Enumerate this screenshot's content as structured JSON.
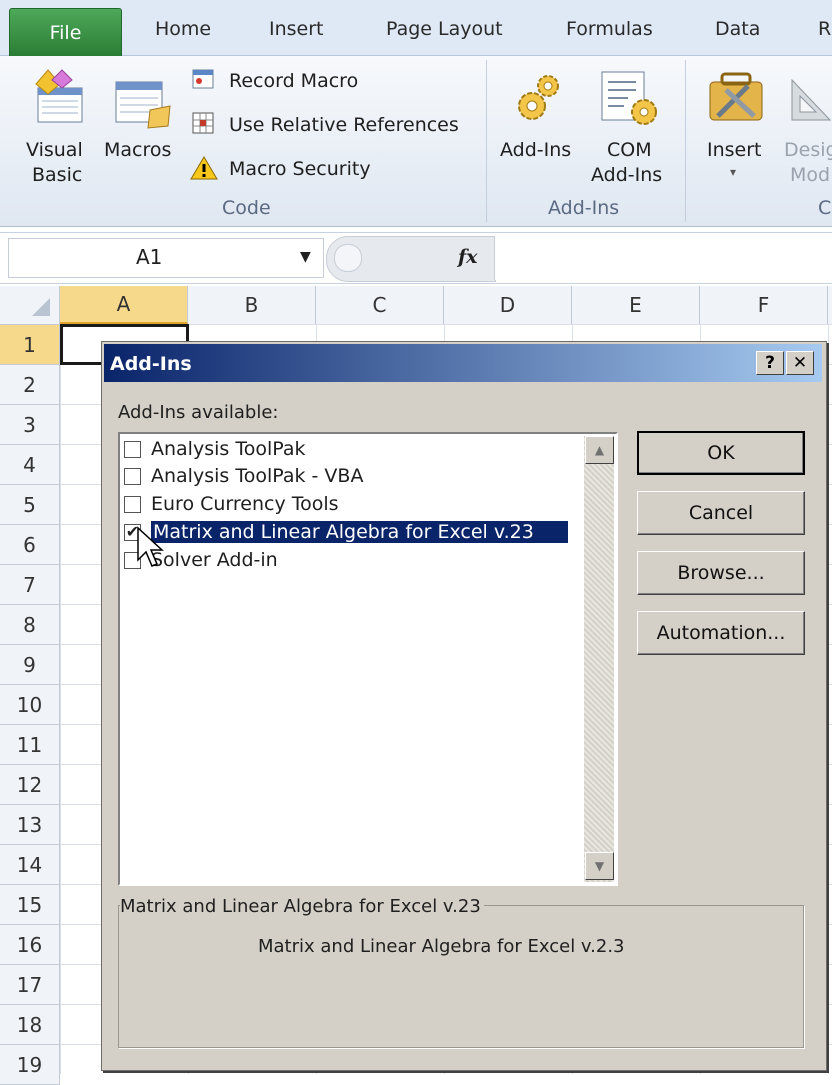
{
  "ribbon": {
    "tabs": [
      "File",
      "Home",
      "Insert",
      "Page Layout",
      "Formulas",
      "Data",
      "R"
    ],
    "code_group": {
      "visual_basic": [
        "Visual",
        "Basic"
      ],
      "macros": "Macros",
      "record_macro": "Record Macro",
      "use_relative": "Use Relative References",
      "macro_security": "Macro Security",
      "label": "Code"
    },
    "addins_group": {
      "addins": "Add-Ins",
      "com": [
        "COM",
        "Add-Ins"
      ],
      "label": "Add-Ins"
    },
    "controls_group": {
      "insert": "Insert",
      "design": [
        "Desig",
        "Mod"
      ],
      "label": "C"
    }
  },
  "formula_bar": {
    "name_box": "A1",
    "fx": "fx"
  },
  "columns": [
    "A",
    "B",
    "C",
    "D",
    "E",
    "F"
  ],
  "rows": [
    "1",
    "2",
    "3",
    "4",
    "5",
    "6",
    "7",
    "8",
    "9",
    "10",
    "11",
    "12",
    "13",
    "14",
    "15",
    "16",
    "17",
    "18",
    "19"
  ],
  "dialog": {
    "title": "Add-Ins",
    "help": "?",
    "close": "✕",
    "available_label": "Add-Ins available:",
    "items": [
      {
        "label": "Analysis ToolPak",
        "checked": false
      },
      {
        "label": "Analysis ToolPak - VBA",
        "checked": false
      },
      {
        "label": "Euro Currency Tools",
        "checked": false
      },
      {
        "label": "Matrix and Linear Algebra for Excel  v.23",
        "checked": true
      },
      {
        "label": "Solver Add-in",
        "checked": false
      }
    ],
    "buttons": {
      "ok": "OK",
      "cancel": "Cancel",
      "browse": "Browse...",
      "automation": "Automation..."
    },
    "description_title": "Matrix and Linear Algebra for Excel  v.23",
    "description_text": "Matrix and Linear Algebra for Excel  v.2.3"
  },
  "colors": {
    "title_start": "#0a246a",
    "title_end": "#a6caf0",
    "selection": "#0a246a",
    "file_tab": "#2f8a3a"
  }
}
